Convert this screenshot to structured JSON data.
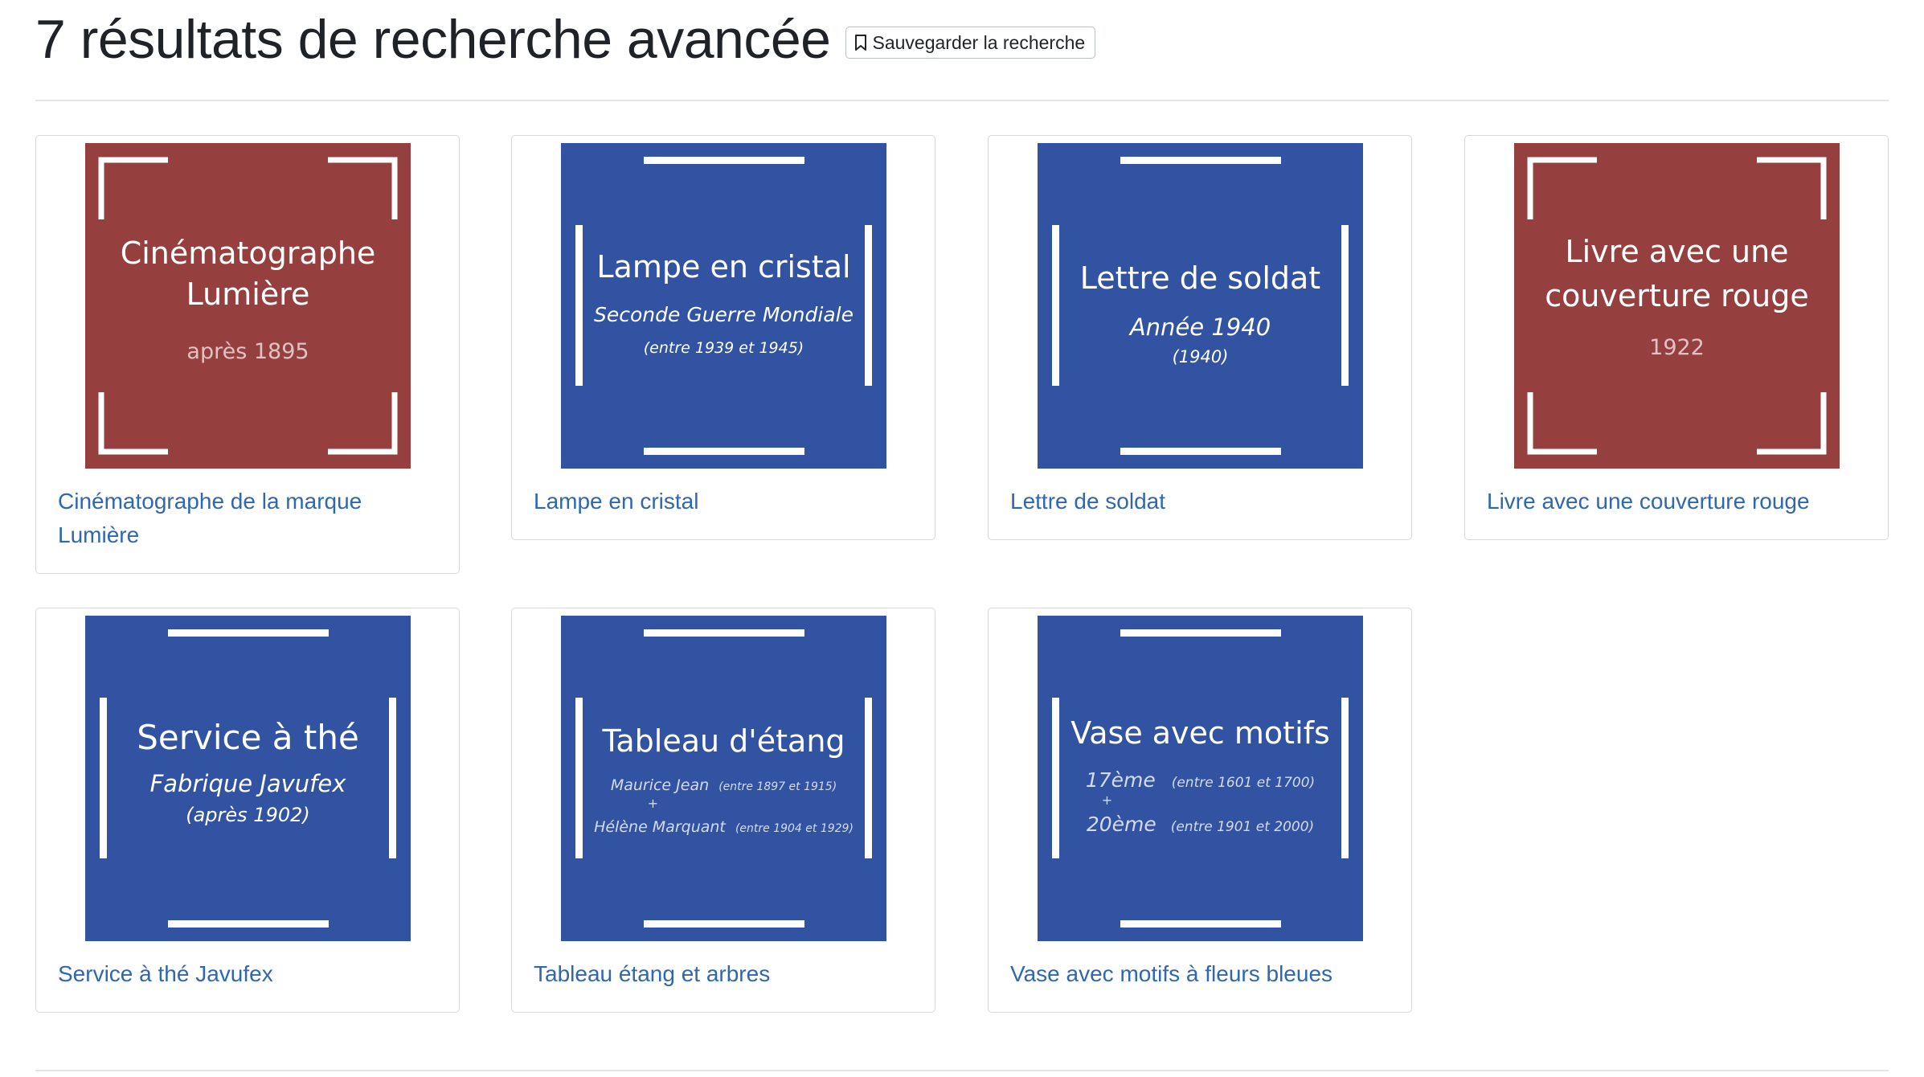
{
  "page": {
    "title": "7 résultats de recherche avancée",
    "save_button_label": "Sauvegarder la recherche",
    "save_icon": "bookmark-icon"
  },
  "colors": {
    "red_tile": "#963f3f",
    "blue_tile": "#3153a1",
    "link": "#2f67b0"
  },
  "results": [
    {
      "caption": "Cinématographe de la marque Lumière",
      "thumb": {
        "color": "red",
        "line1": "Cinématographe",
        "line2": "Lumière",
        "line3": "après 1895"
      }
    },
    {
      "caption": "Lampe en cristal",
      "thumb": {
        "color": "blue",
        "line1": "Lampe en cristal",
        "line2": "Seconde Guerre Mondiale",
        "line3": "(entre 1939 et 1945)"
      }
    },
    {
      "caption": "Lettre de soldat",
      "thumb": {
        "color": "blue",
        "line1": "Lettre de soldat",
        "line2": "Année 1940",
        "line3": "(1940)"
      }
    },
    {
      "caption": "Livre avec une couverture rouge",
      "thumb": {
        "color": "red",
        "line1": "Livre avec une",
        "line2": "couverture rouge",
        "line3": "1922"
      }
    },
    {
      "caption": "Service à thé Javufex",
      "thumb": {
        "color": "blue",
        "line1": "Service à thé",
        "line2": "Fabrique Javufex",
        "line3": "(après 1902)"
      }
    },
    {
      "caption": "Tableau étang et arbres",
      "thumb": {
        "color": "blue",
        "line1": "Tableau d'étang",
        "line2": "Maurice Jean",
        "line2b": "(entre 1897 et 1915)",
        "plus": "+",
        "line3": "Hélène Marquant",
        "line3b": "(entre 1904 et 1929)"
      }
    },
    {
      "caption": "Vase avec motifs à fleurs bleues",
      "thumb": {
        "color": "blue",
        "line1": "Vase avec motifs",
        "line2": "17ème",
        "line2b": "(entre 1601 et 1700)",
        "plus": "+",
        "line3": "20ème",
        "line3b": "(entre 1901 et 2000)"
      }
    }
  ]
}
